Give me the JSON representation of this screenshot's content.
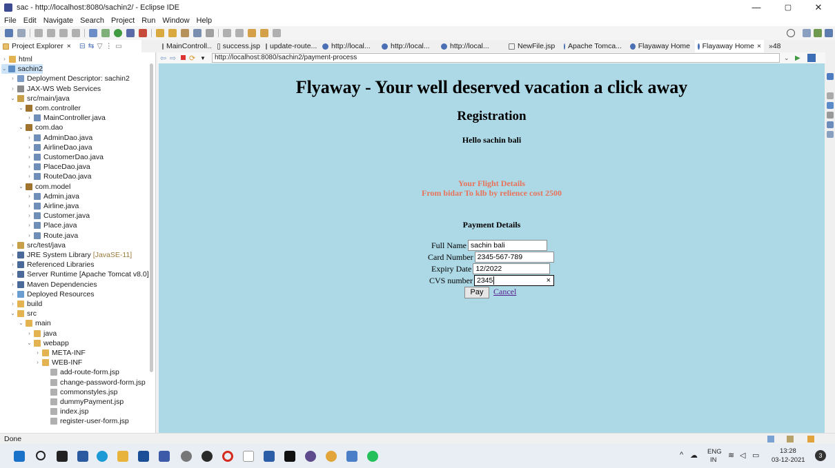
{
  "window": {
    "title": "sac - http://localhost:8080/sachin2/ - Eclipse IDE",
    "minimize": "—",
    "maximize": "▢",
    "close": "✕"
  },
  "menu": [
    "File",
    "Edit",
    "Navigate",
    "Search",
    "Project",
    "Run",
    "Window",
    "Help"
  ],
  "perspective_tabs": {
    "project_explorer": "Project Explorer",
    "editor_tabs": [
      "MainControll...",
      "success.jsp",
      "update-route...",
      "http://local...",
      "http://local...",
      "http://local...",
      "NewFile.jsp",
      "Apache Tomca...",
      "Flayaway Home",
      "Flayaway Home"
    ],
    "overflow": "»48"
  },
  "tree": [
    {
      "label": "html",
      "level": 0,
      "arrow": "›",
      "icon": "folder"
    },
    {
      "label": "sachin2",
      "level": 0,
      "arrow": "⌄",
      "icon": "project",
      "selected": true
    },
    {
      "label": "Deployment Descriptor: sachin2",
      "level": 1,
      "arrow": "›",
      "icon": "descriptor"
    },
    {
      "label": "JAX-WS Web Services",
      "level": 1,
      "arrow": "›",
      "icon": "ws"
    },
    {
      "label": "src/main/java",
      "level": 1,
      "arrow": "⌄",
      "icon": "srcfolder"
    },
    {
      "label": "com.controller",
      "level": 2,
      "arrow": "⌄",
      "icon": "package"
    },
    {
      "label": "MainController.java",
      "level": 3,
      "arrow": "›",
      "icon": "java"
    },
    {
      "label": "com.dao",
      "level": 2,
      "arrow": "⌄",
      "icon": "package"
    },
    {
      "label": "AdminDao.java",
      "level": 3,
      "arrow": "›",
      "icon": "java"
    },
    {
      "label": "AirlineDao.java",
      "level": 3,
      "arrow": "›",
      "icon": "java"
    },
    {
      "label": "CustomerDao.java",
      "level": 3,
      "arrow": "›",
      "icon": "java"
    },
    {
      "label": "PlaceDao.java",
      "level": 3,
      "arrow": "›",
      "icon": "java"
    },
    {
      "label": "RouteDao.java",
      "level": 3,
      "arrow": "›",
      "icon": "java"
    },
    {
      "label": "com.model",
      "level": 2,
      "arrow": "⌄",
      "icon": "package"
    },
    {
      "label": "Admin.java",
      "level": 3,
      "arrow": "›",
      "icon": "java"
    },
    {
      "label": "Airline.java",
      "level": 3,
      "arrow": "›",
      "icon": "java"
    },
    {
      "label": "Customer.java",
      "level": 3,
      "arrow": "›",
      "icon": "java"
    },
    {
      "label": "Place.java",
      "level": 3,
      "arrow": "›",
      "icon": "java"
    },
    {
      "label": "Route.java",
      "level": 3,
      "arrow": "›",
      "icon": "java"
    },
    {
      "label": "src/test/java",
      "level": 1,
      "arrow": "›",
      "icon": "srcfolder"
    },
    {
      "label": "JRE System Library",
      "suffix": "[JavaSE-11]",
      "level": 1,
      "arrow": "›",
      "icon": "library"
    },
    {
      "label": "Referenced Libraries",
      "level": 1,
      "arrow": "›",
      "icon": "library"
    },
    {
      "label": "Server Runtime [Apache Tomcat v8.0]",
      "level": 1,
      "arrow": "›",
      "icon": "library"
    },
    {
      "label": "Maven Dependencies",
      "level": 1,
      "arrow": "›",
      "icon": "library"
    },
    {
      "label": "Deployed Resources",
      "level": 1,
      "arrow": "›",
      "icon": "deployed"
    },
    {
      "label": "build",
      "level": 1,
      "arrow": "›",
      "icon": "folder"
    },
    {
      "label": "src",
      "level": 1,
      "arrow": "⌄",
      "icon": "folder"
    },
    {
      "label": "main",
      "level": 2,
      "arrow": "⌄",
      "icon": "folder"
    },
    {
      "label": "java",
      "level": 3,
      "arrow": "›",
      "icon": "folder"
    },
    {
      "label": "webapp",
      "level": 3,
      "arrow": "⌄",
      "icon": "folder"
    },
    {
      "label": "META-INF",
      "level": 4,
      "arrow": "›",
      "icon": "folder"
    },
    {
      "label": "WEB-INF",
      "level": 4,
      "arrow": "›",
      "icon": "folder"
    },
    {
      "label": "add-route-form.jsp",
      "level": 5,
      "arrow": "",
      "icon": "file"
    },
    {
      "label": "change-password-form.jsp",
      "level": 5,
      "arrow": "",
      "icon": "file"
    },
    {
      "label": "commonstyles.jsp",
      "level": 5,
      "arrow": "",
      "icon": "file"
    },
    {
      "label": "dummyPayment.jsp",
      "level": 5,
      "arrow": "",
      "icon": "file"
    },
    {
      "label": "index.jsp",
      "level": 5,
      "arrow": "",
      "icon": "file"
    },
    {
      "label": "register-user-form.jsp",
      "level": 5,
      "arrow": "",
      "icon": "file"
    }
  ],
  "browser": {
    "url": "http://localhost:8080/sachin2/payment-process"
  },
  "page": {
    "heading": "Flyaway - Your well deserved vacation a click away",
    "subheading": "Registration",
    "greeting": "Hello sachin bali",
    "flight_title": "Your Flight Details",
    "flight_info": "From bidar To klb by relience cost 2500",
    "payment_heading": "Payment Details",
    "fields": {
      "full_name_label": "Full Name",
      "full_name_value": "sachin bali",
      "card_number_label": "Card Number",
      "card_number_value": "2345-567-789",
      "expiry_label": "Expiry Date",
      "expiry_value": "12/2022",
      "cvs_label": "CVS number",
      "cvs_value": "2345",
      "clear": "×"
    },
    "pay_button": "Pay",
    "cancel_link": "Cancel"
  },
  "status": {
    "text": "Done"
  },
  "tray": {
    "lang": "ENG",
    "region": "IN",
    "time": "13:28",
    "date": "03-12-2021",
    "notifications": "3"
  },
  "colors": {
    "page_bg": "#add8e6",
    "flight_text": "#e8735a",
    "link": "#551a8b",
    "selection": "#cde3f7"
  }
}
